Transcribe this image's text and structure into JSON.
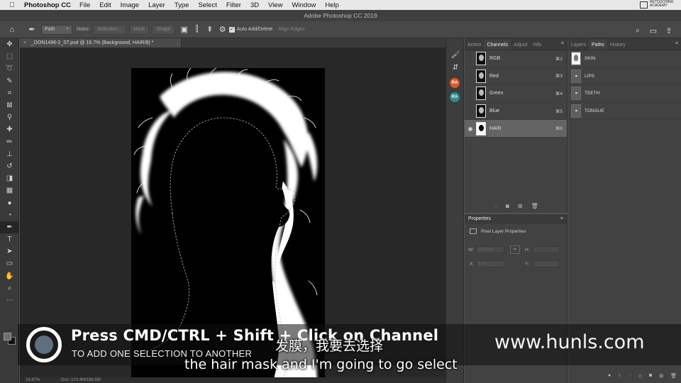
{
  "menubar": {
    "app": "Photoshop CC",
    "items": [
      "File",
      "Edit",
      "Image",
      "Layer",
      "Type",
      "Select",
      "Filter",
      "3D",
      "View",
      "Window",
      "Help"
    ],
    "logo_text": "RETOUCHING ACADEMY"
  },
  "window": {
    "title": "Adobe Photoshop CC 2019"
  },
  "options": {
    "mode": "Path",
    "make_label": "Make:",
    "selection_btn": "Selection...",
    "mask_btn": "Mask",
    "shape_btn": "Shape",
    "auto_add_delete": "Auto Add/Delete",
    "align_edges": "Align Edges",
    "icons": [
      "home-icon",
      "pen-icon",
      "search-icon",
      "workspace-icon",
      "share-icon"
    ]
  },
  "document": {
    "tab_title": "_DON1496-2_ST.psd @ 16.7% (Background, HAIR/8) *",
    "zoom": "16.67%",
    "doc_size": "Doc: 103.4M/186.5M"
  },
  "tools": [
    "move",
    "marquee",
    "lasso",
    "quick-select",
    "crop",
    "frame",
    "eyedropper",
    "healing",
    "brush",
    "stamp",
    "history-brush",
    "eraser",
    "gradient",
    "blur",
    "dodge",
    "pen",
    "type",
    "path-select",
    "rectangle",
    "hand",
    "zoom",
    "more"
  ],
  "strip": {
    "ra1": "RA",
    "ra2": "RA",
    "ra_colors": [
      "#d9572c",
      "#2d8c8c"
    ]
  },
  "channels": {
    "tabs": [
      "Action",
      "Channels",
      "Adjust",
      "Info"
    ],
    "active_tab": "Channels",
    "rows": [
      {
        "name": "RGB",
        "shortcut": "⌘2"
      },
      {
        "name": "Red",
        "shortcut": "⌘3"
      },
      {
        "name": "Green",
        "shortcut": "⌘4"
      },
      {
        "name": "Blue",
        "shortcut": "⌘5"
      },
      {
        "name": "HAIR",
        "shortcut": "⌘6"
      }
    ]
  },
  "properties": {
    "title": "Properties",
    "subtitle": "Pixel Layer Properties",
    "w_label": "W:",
    "w_value": "18.37 in",
    "h_label": "H:",
    "x_label": "X:",
    "x_value": "0 px",
    "y_label": "Y:"
  },
  "paths": {
    "tabs": [
      "Layers",
      "Paths",
      "History"
    ],
    "active_tab": "Paths",
    "rows": [
      "SKIN",
      "LIPS",
      "TEETH",
      "TONGUE"
    ]
  },
  "overlay": {
    "headline": "Press CMD/CTRL + Shift + Click on Channel",
    "subline": "TO ADD ONE SELECTION TO ANOTHER",
    "caption_cn": "发膜，我要去选择",
    "caption_en": "the hair mask and I'm going to go select",
    "watermark": "www.hunls.com"
  }
}
